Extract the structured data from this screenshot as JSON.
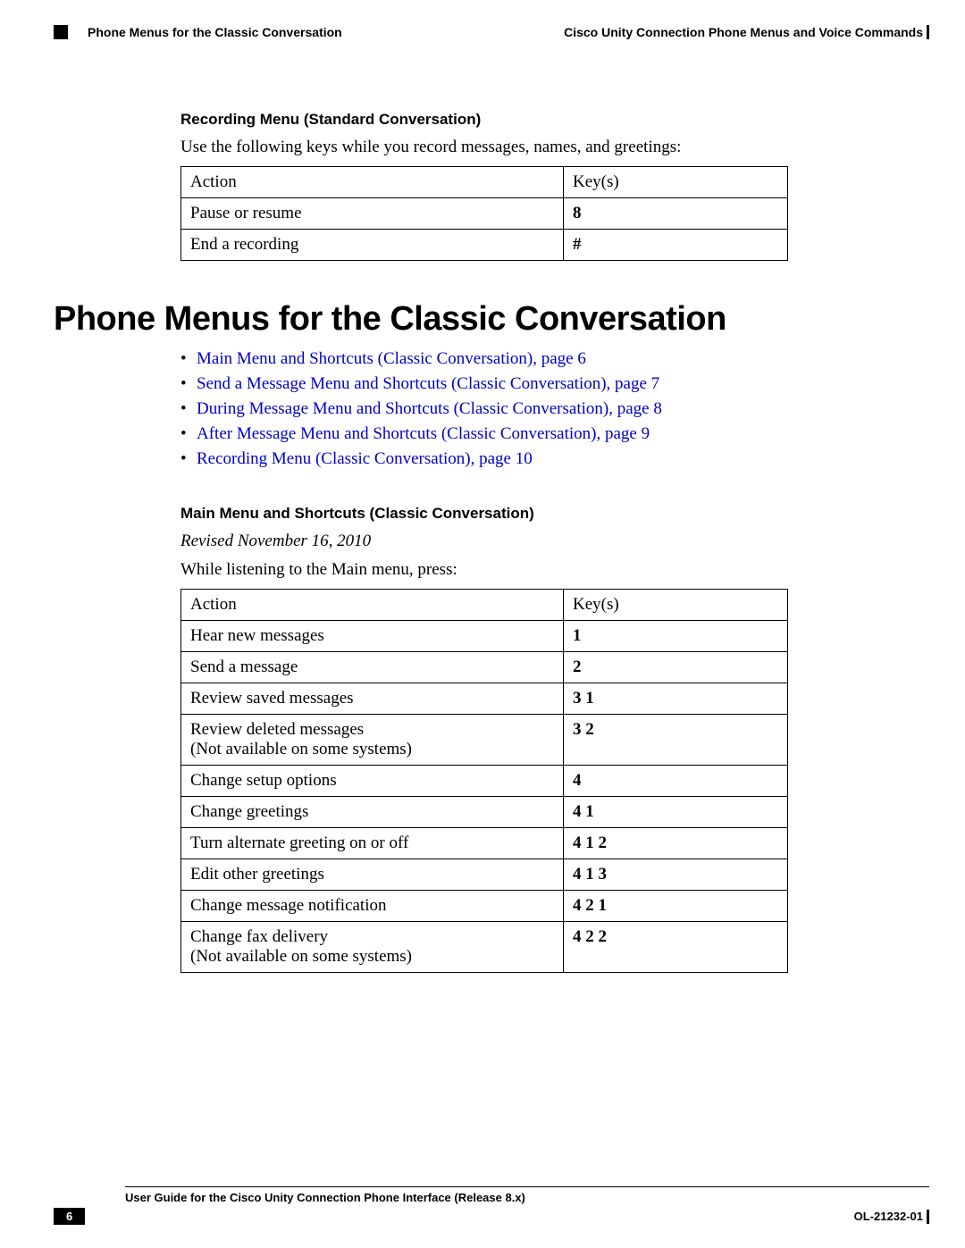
{
  "header": {
    "left": "Phone Menus for the Classic Conversation",
    "right": "Cisco Unity Connection Phone Menus and Voice Commands"
  },
  "sec1": {
    "title": "Recording Menu (Standard Conversation)",
    "intro": "Use the following keys while you record messages, names, and greetings:",
    "col_action": "Action",
    "col_keys": "Key(s)",
    "rows": [
      {
        "action": "Pause or resume",
        "key": "8"
      },
      {
        "action": "End a recording",
        "key": "#"
      }
    ]
  },
  "h1": "Phone Menus for the Classic Conversation",
  "links": [
    "Main Menu and Shortcuts (Classic Conversation),  page 6",
    "Send a Message Menu and Shortcuts (Classic Conversation),  page 7",
    "During Message Menu and Shortcuts (Classic Conversation),  page 8",
    "After Message Menu and Shortcuts (Classic Conversation),  page 9",
    "Recording Menu (Classic Conversation),  page 10"
  ],
  "sec2": {
    "title": "Main Menu and Shortcuts (Classic Conversation)",
    "revised": "Revised November 16, 2010",
    "intro": "While listening to the Main menu, press:",
    "col_action": "Action",
    "col_keys": "Key(s)",
    "rows": [
      {
        "action": "Hear new messages",
        "note": "",
        "key": "1"
      },
      {
        "action": "Send a message",
        "note": "",
        "key": "2"
      },
      {
        "action": "Review saved messages",
        "note": "",
        "key": "3 1"
      },
      {
        "action": "Review deleted messages",
        "note": "(Not available on some systems)",
        "key": "3 2"
      },
      {
        "action": "Change setup options",
        "note": "",
        "key": "4"
      },
      {
        "action": "Change greetings",
        "note": "",
        "key": "4 1"
      },
      {
        "action": "Turn alternate greeting on or off",
        "note": "",
        "key": "4 1 2"
      },
      {
        "action": "Edit other greetings",
        "note": "",
        "key": "4 1 3"
      },
      {
        "action": "Change message notification",
        "note": "",
        "key": "4 2 1"
      },
      {
        "action": "Change fax delivery",
        "note": "(Not available on some systems)",
        "key": "4 2 2"
      }
    ]
  },
  "footer": {
    "title": "User Guide for the Cisco Unity Connection Phone Interface (Release 8.x)",
    "page": "6",
    "docid": "OL-21232-01"
  }
}
